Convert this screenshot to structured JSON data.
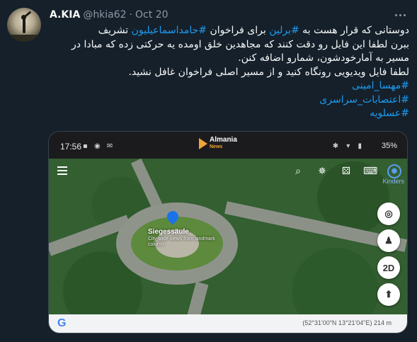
{
  "author": {
    "name": "A.KIA",
    "handle": "@hkia62",
    "separator": "·",
    "date": "Oct 20"
  },
  "tweet": {
    "line1_prefix": "دوستانی که قرار هست به ",
    "line1_tag1": "#برلین",
    "line1_mid": " برای فراخوان ",
    "line1_tag2": "#حامداسماعیلیون",
    "line1_suffix": " تشریف",
    "line2": "ببرن لطفا این فایل رو دقت کنند که مجاهدین خلق اومده یه حرکتی زده که مبادا در",
    "line3": "مسیر به آمارخودشون، شمارو اضافه کنن.",
    "line4": "لطفا فایل ویدیویی رونگاه کنید و از مسیر اصلی فراخوان غافل نشید.",
    "hashtags": [
      "#مهسا_امینی",
      "#اعتصابات_سراسری",
      "#عسلویه"
    ]
  },
  "media": {
    "status_time": "17:56",
    "status_battery": "35%",
    "logo_name": "Almania",
    "logo_sub": "News",
    "place_name": "Siegessäule",
    "place_sub": "City-wide views from landmark column",
    "kinder_label": "Kinders",
    "fab_2d": "2D",
    "google_logo": "G",
    "coords": "(52°31'00\"N 13°21'04\"E) 214 m"
  },
  "colors": {
    "background": "#15202b",
    "text": "#f7f9f9",
    "muted": "#8b98a5",
    "link": "#1d9bf0"
  }
}
